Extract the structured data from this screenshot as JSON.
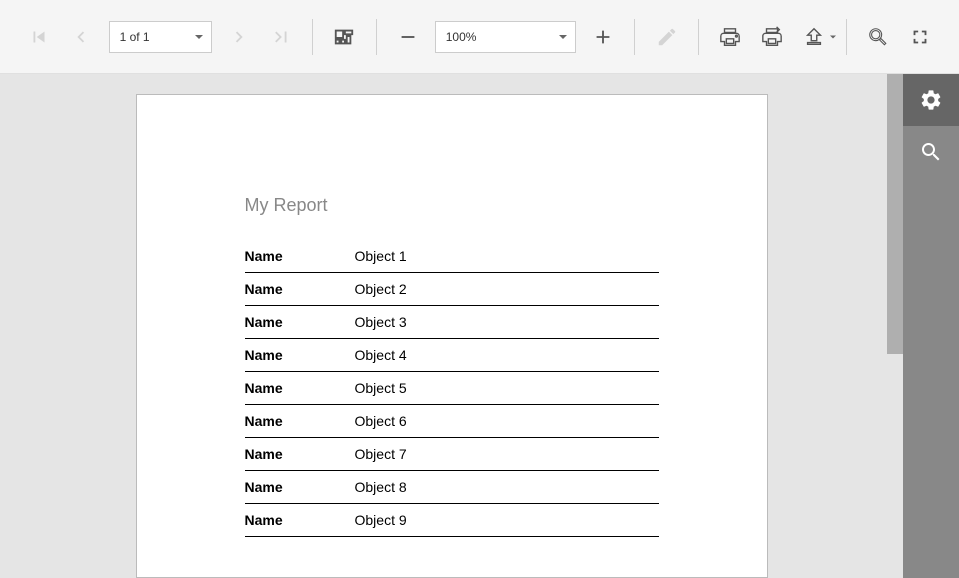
{
  "toolbar": {
    "page_label": "1 of 1",
    "zoom_label": "100%"
  },
  "report": {
    "title": "My Report",
    "rows": [
      {
        "label": "Name",
        "value": "Object 1"
      },
      {
        "label": "Name",
        "value": "Object 2"
      },
      {
        "label": "Name",
        "value": "Object 3"
      },
      {
        "label": "Name",
        "value": "Object 4"
      },
      {
        "label": "Name",
        "value": "Object 5"
      },
      {
        "label": "Name",
        "value": "Object 6"
      },
      {
        "label": "Name",
        "value": "Object 7"
      },
      {
        "label": "Name",
        "value": "Object 8"
      },
      {
        "label": "Name",
        "value": "Object 9"
      }
    ]
  }
}
